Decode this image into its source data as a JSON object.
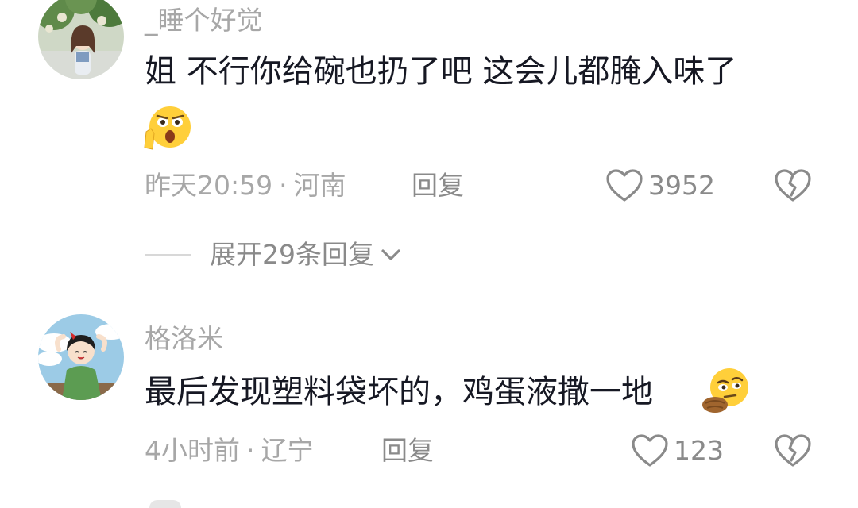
{
  "comments": [
    {
      "username": "_睡个好觉",
      "text": "姐 不行你给碗也扔了吧 这会儿都腌入味了",
      "emoji": "shocked-emoji",
      "time": "昨天20:59",
      "dot": "·",
      "location": "河南",
      "reply_label": "回复",
      "likes": "3952",
      "expand_label": "展开29条回复"
    },
    {
      "username": "格洛米",
      "text": "最后发现塑料袋坏的，鸡蛋液撒一地",
      "emoji": "thinking-emoji",
      "time": "4小时前",
      "dot": "·",
      "location": "辽宁",
      "reply_label": "回复",
      "likes": "123"
    }
  ],
  "colors": {
    "meta_gray": "#a7a7a7",
    "text_dark": "#161823",
    "icon_gray": "#8a8a8a"
  }
}
